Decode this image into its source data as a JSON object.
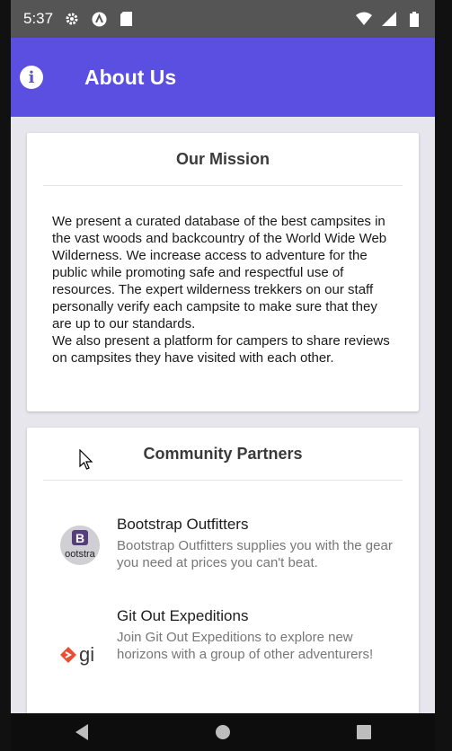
{
  "status_bar": {
    "time": "5:37",
    "icons_left": [
      "gear-icon",
      "a-circle-icon",
      "sd-card-icon"
    ],
    "icons_right": [
      "wifi-icon",
      "signal-icon",
      "battery-icon"
    ]
  },
  "app_bar": {
    "title": "About Us",
    "icon": "info-icon",
    "color": "#5a4fe0"
  },
  "mission": {
    "title": "Our Mission",
    "paragraph_1": "We present a curated database of the best campsites in the vast woods and backcountry of the World Wide Web Wilderness. We increase access to adventure for the public while promoting safe and respectful use of resources. The expert wilderness trekkers on our staff personally verify each campsite to make sure that they are up to our standards.",
    "paragraph_2": "We also present a platform for campers to share reviews on campsites they have visited with each other."
  },
  "partners": {
    "title": "Community Partners",
    "items": [
      {
        "name": "Bootstrap Outfitters",
        "description": "Bootstrap Outfitters supplies you with the gear you need at prices you can't beat.",
        "logo_letter": "B",
        "logo_text": "ootstra"
      },
      {
        "name": "Git Out Expeditions",
        "description": "Join Git Out Expeditions to explore new horizons with a group of other adventurers!",
        "logo_text": "gi"
      }
    ]
  },
  "nav_bar": {
    "buttons": [
      "back-icon",
      "home-icon",
      "recents-icon"
    ]
  }
}
